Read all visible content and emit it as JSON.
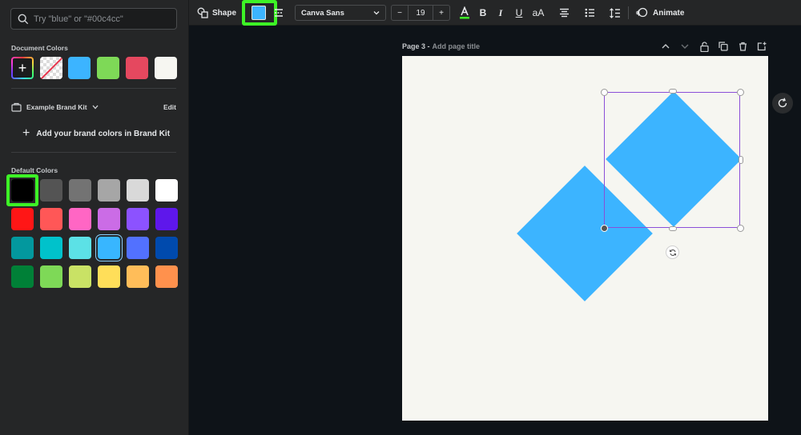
{
  "search": {
    "placeholder": "Try \"blue\" or \"#00c4cc\""
  },
  "document_colors": {
    "label": "Document Colors",
    "swatches": [
      "#3cb4ff",
      "#7ed957",
      "#e5485f",
      "#f6f6f1"
    ]
  },
  "brand_kit": {
    "name": "Example Brand Kit",
    "edit_label": "Edit",
    "add_label": "Add your brand colors in Brand Kit"
  },
  "default_colors": {
    "label": "Default Colors",
    "rows": [
      [
        "#000000",
        "#545454",
        "#737373",
        "#a6a6a6",
        "#d9d9d9",
        "#ffffff"
      ],
      [
        "#ff1616",
        "#ff5757",
        "#ff66c4",
        "#cb6ce6",
        "#8c52ff",
        "#5e17eb"
      ],
      [
        "#03989e",
        "#00c2cb",
        "#5ce1e6",
        "#38b6ff",
        "#5271ff",
        "#004aad"
      ],
      [
        "#008037",
        "#7ed957",
        "#c9e265",
        "#ffde59",
        "#ffbd59",
        "#ff914d"
      ]
    ]
  },
  "toolbar": {
    "shape_label": "Shape",
    "fill_color": "#3cb4ff",
    "font": "Canva Sans",
    "font_size": "19",
    "decrease": "−",
    "increase": "+",
    "animate_label": "Animate"
  },
  "page": {
    "label": "Page 3 -",
    "title_placeholder": "Add page title"
  },
  "colors": {
    "highlight": "#3df326",
    "selection": "#8a4fd8",
    "shape_fill": "#3cb4ff"
  }
}
